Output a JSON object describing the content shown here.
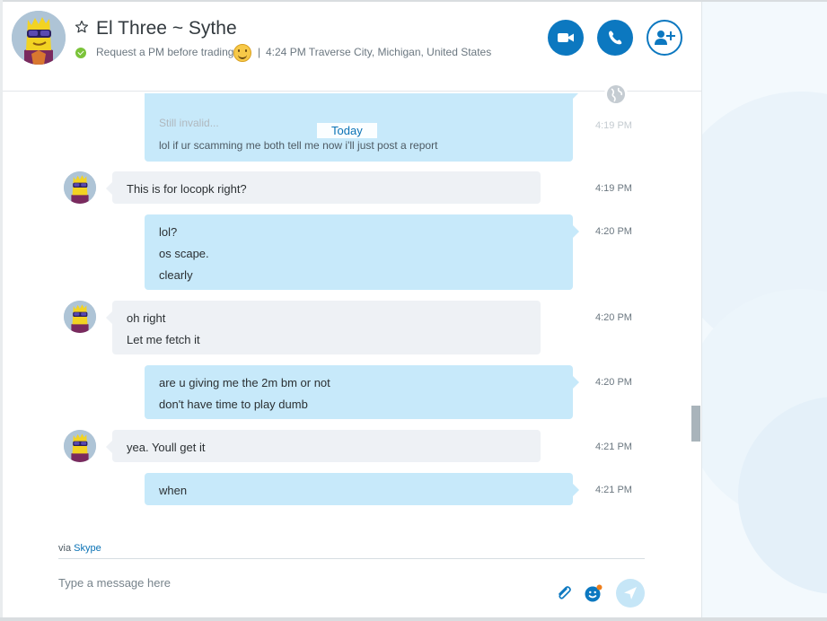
{
  "header": {
    "contact_name": "El Three ~ Sythe",
    "mood": "Request a PM before trading",
    "separator": "|",
    "local_time_location": "4:24 PM Traverse City, Michigan, United States",
    "status": "online",
    "buttons": {
      "video_call": "video-call",
      "voice_call": "voice-call",
      "add_people": "add-people"
    }
  },
  "conversation": {
    "date_divider": "Today",
    "ghost_preview": {
      "line1": "Still invalid...",
      "line2": "lol if ur scamming me both tell me now i'll just post a report",
      "time": "4:19 PM"
    },
    "messages": [
      {
        "direction": "in",
        "lines": [
          "This is for locopk right?"
        ],
        "time": "4:19 PM"
      },
      {
        "direction": "out",
        "lines": [
          "lol?",
          "os scape.",
          "clearly"
        ],
        "time": "4:20 PM"
      },
      {
        "direction": "in",
        "lines": [
          "oh right",
          "Let me fetch it"
        ],
        "time": "4:20 PM"
      },
      {
        "direction": "out",
        "lines": [
          "are u giving me the 2m bm or not",
          "don't have time to play dumb"
        ],
        "time": "4:20 PM"
      },
      {
        "direction": "in",
        "lines": [
          "yea. Youll get it"
        ],
        "time": "4:21 PM"
      },
      {
        "direction": "out",
        "lines": [
          "when"
        ],
        "time": "4:21 PM"
      }
    ]
  },
  "footer": {
    "via_prefix": "via",
    "via_link": "Skype",
    "compose_placeholder": "Type a message here"
  },
  "colors": {
    "accent": "#0c78c0",
    "incoming_bubble": "#eef1f5",
    "outgoing_bubble": "#c7e9fa",
    "presence_online": "#7bc33a"
  },
  "icons": [
    "star-icon",
    "presence-icon",
    "emoticon-icon",
    "video-icon",
    "phone-icon",
    "add-contact-icon",
    "globe-icon",
    "paperclip-icon",
    "emoji-icon",
    "send-icon"
  ]
}
